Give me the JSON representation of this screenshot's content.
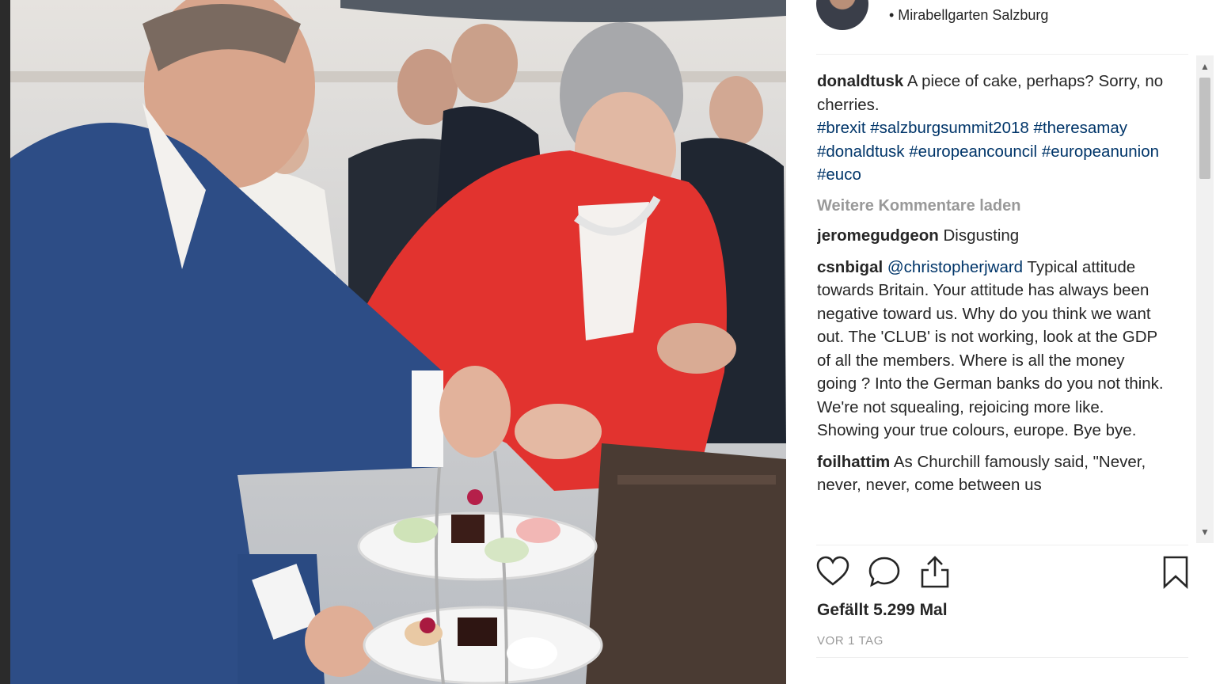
{
  "post": {
    "location": "• Mirabellgarten Salzburg",
    "caption": {
      "user": "donaldtusk",
      "text": "A piece of cake, perhaps? Sorry, no cherries.",
      "tags": [
        "#brexit",
        "#salzburgsummit2018",
        "#theresamay",
        "#donaldtusk",
        "#europeancouncil",
        "#europeanunion",
        "#euco"
      ]
    },
    "load_more": "Weitere Kommentare laden",
    "comments": [
      {
        "user": "jeromegudgeon",
        "mention": "",
        "text": "Disgusting"
      },
      {
        "user": "csnbigal",
        "mention": "@christopherjward",
        "text": "Typical attitude towards Britain. Your attitude has always been negative toward us. Why do you think we want out. The 'CLUB' is not working, look at the GDP of all the members. Where is all the money going ? Into the German banks do you not think. We're not squealing, rejoicing more like. Showing your true colours, europe. Bye bye."
      },
      {
        "user": "foilhattim",
        "mention": "",
        "text": "As Churchill famously said, \"Never, never, never, come between us"
      }
    ],
    "likes": "Gefällt 5.299 Mal",
    "time": "VOR 1 TAG"
  },
  "icons": {
    "like": "heart-icon",
    "comment": "comment-icon",
    "share": "share-icon",
    "save": "bookmark-icon"
  },
  "colors": {
    "text": "#262626",
    "link": "#003569",
    "muted": "#999999"
  }
}
